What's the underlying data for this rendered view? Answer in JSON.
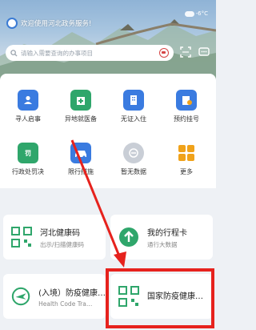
{
  "header": {
    "greeting": "欢迎使用河北政务服务!",
    "weather": "-6°C"
  },
  "search": {
    "placeholder": "请输入需要查询的办事项目"
  },
  "grid": [
    {
      "label": "寻人启事",
      "icon": "person-card-icon",
      "color": "#3a7be0"
    },
    {
      "label": "异地就医备",
      "icon": "hospital-icon",
      "color": "#2fa66b"
    },
    {
      "label": "无证入住",
      "icon": "building-icon",
      "color": "#3a7be0"
    },
    {
      "label": "预约挂号",
      "icon": "clinic-icon",
      "color": "#3a7be0"
    },
    {
      "label": "行政处罚决",
      "icon": "penalty-icon",
      "color": "#2fa66b"
    },
    {
      "label": "限行措施",
      "icon": "car-icon",
      "color": "#3a7be0"
    },
    {
      "label": "暂无数据",
      "icon": "empty-icon",
      "color": "#b9bec6"
    },
    {
      "label": "更多",
      "icon": "more-grid-icon",
      "color": "#f0a21a"
    }
  ],
  "cards": {
    "health_code": {
      "title": "河北健康码",
      "sub": "出示/扫描健康码"
    },
    "itinerary": {
      "title": "我的行程卡",
      "sub": "通行大数据"
    },
    "entry": {
      "title": "(入境）防疫健康…",
      "sub": "Health Code Tra…"
    },
    "national": {
      "title": "国家防疫健康…",
      "sub": ""
    }
  },
  "colors": {
    "accent_green": "#2fa66b",
    "accent_blue": "#3a7be0",
    "annotation_red": "#e6221d"
  }
}
